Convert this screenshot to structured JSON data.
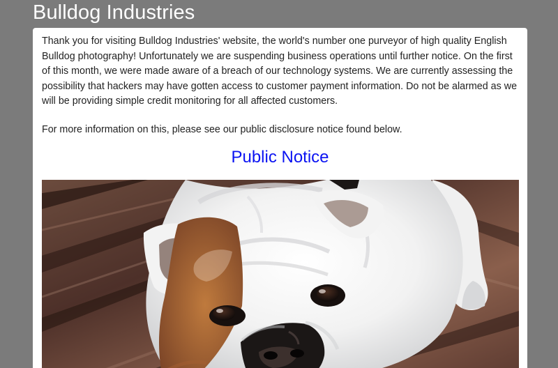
{
  "site": {
    "title": "Bulldog Industries"
  },
  "main": {
    "intro_paragraph": "Thank you for visiting Bulldog Industries' website, the world's number one purveyor of high quality English Bulldog photography! Unfortunately we are suspending business operations until further notice. On the first of this month, we were made aware of a breach of our technology systems. We are currently assessing the possibility that hackers may have gotten access to customer payment information. Do not be alarmed as we will be providing simple credit monitoring for all affected customers.",
    "more_info": "For more information on this, please see our public disclosure notice found below.",
    "notice_link": "Public Notice"
  },
  "colors": {
    "page_background": "#7b7b7b",
    "card_background": "#ffffff",
    "link": "#0b13f2",
    "body_text": "#222222"
  },
  "icons": {
    "photo": "english-bulldog-photo"
  }
}
